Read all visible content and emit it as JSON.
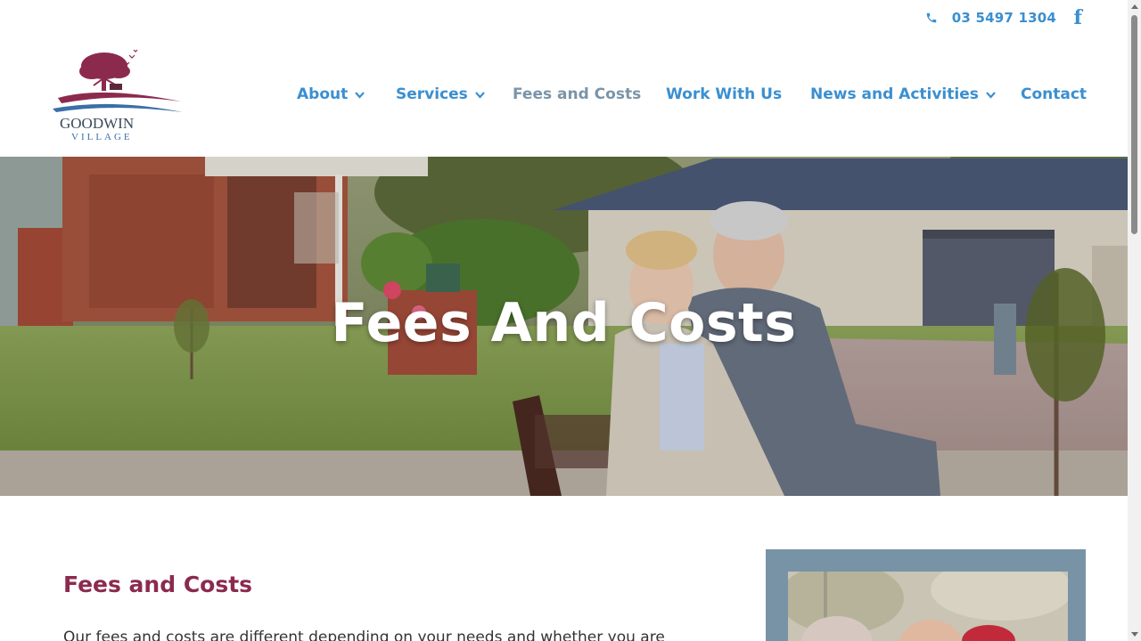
{
  "topbar": {
    "phone": "03 5497 1304",
    "phone_icon": "phone-icon",
    "facebook_icon": "facebook-icon",
    "facebook_glyph": "f"
  },
  "logo": {
    "line1": "GOODWIN",
    "line2": "VILLAGE"
  },
  "nav": {
    "items": [
      {
        "label": "About",
        "has_dropdown": true
      },
      {
        "label": "Services",
        "has_dropdown": true
      },
      {
        "label": "Fees and Costs",
        "has_dropdown": false,
        "current": true
      },
      {
        "label": "Work With Us",
        "has_dropdown": false
      },
      {
        "label": "News and Activities",
        "has_dropdown": true
      },
      {
        "label": "Contact",
        "has_dropdown": false
      }
    ]
  },
  "hero": {
    "title": "Fees And Costs"
  },
  "content": {
    "title": "Fees and Costs",
    "paragraph": "Our fees and costs are different depending on your needs and whether you are"
  },
  "colors": {
    "link": "#3a8fd0",
    "current_nav": "#7a94a8",
    "heading": "#8c2a4e",
    "side_box": "#7893a6"
  }
}
